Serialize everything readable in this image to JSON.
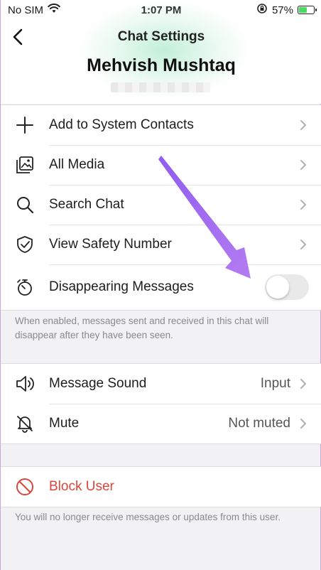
{
  "status_bar": {
    "carrier": "No SIM",
    "time": "1:07 PM",
    "battery_percent": "57%",
    "battery_level": 0.57,
    "icons": [
      "wifi-icon",
      "orientation-lock-icon",
      "battery-icon"
    ]
  },
  "header": {
    "title": "Chat Settings",
    "contact_name": "Mehvish Mushtaq"
  },
  "sections": {
    "main": [
      {
        "label": "Add to System Contacts",
        "icon": "plus-icon"
      },
      {
        "label": "All Media",
        "icon": "media-gallery-icon"
      },
      {
        "label": "Search Chat",
        "icon": "search-icon"
      },
      {
        "label": "View Safety Number",
        "icon": "shield-check-icon"
      },
      {
        "label": "Disappearing Messages",
        "icon": "timer-icon",
        "toggle": false
      }
    ],
    "main_footnote": "When enabled, messages sent and received in this chat will disappear after they have been seen.",
    "sound": [
      {
        "label": "Message Sound",
        "value": "Input",
        "icon": "speaker-icon"
      },
      {
        "label": "Mute",
        "value": "Not muted",
        "icon": "bell-off-icon"
      }
    ],
    "block": {
      "label": "Block User",
      "icon": "block-icon"
    },
    "block_footnote": "You will no longer receive messages or updates from this user."
  },
  "colors": {
    "accent_red": "#d9473a",
    "annotation_arrow": "#a56ef0",
    "toggle_off": "#e9e9ea"
  }
}
